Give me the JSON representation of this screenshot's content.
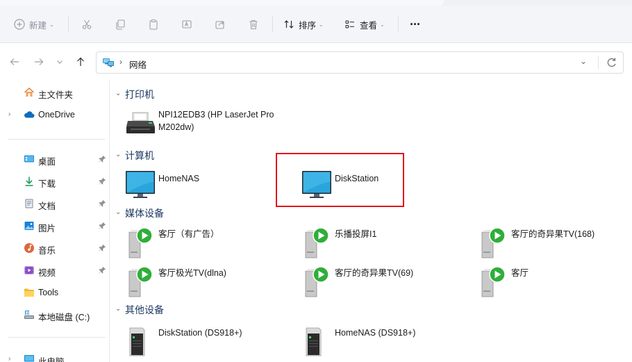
{
  "toolbar": {
    "new_label": "新建",
    "sort_label": "排序",
    "view_label": "查看",
    "more": "···"
  },
  "address": {
    "location": "网络"
  },
  "sidebar": {
    "items": [
      {
        "label": "主文件夹",
        "icon": "home-icon"
      },
      {
        "label": "OneDrive",
        "icon": "cloud-icon"
      },
      {
        "label": "桌面",
        "icon": "desktop-icon"
      },
      {
        "label": "下载",
        "icon": "download-icon"
      },
      {
        "label": "文档",
        "icon": "document-icon"
      },
      {
        "label": "图片",
        "icon": "picture-icon"
      },
      {
        "label": "音乐",
        "icon": "music-icon"
      },
      {
        "label": "视频",
        "icon": "video-icon"
      },
      {
        "label": "Tools",
        "icon": "folder-icon"
      },
      {
        "label": "本地磁盘 (C:)",
        "icon": "drive-icon"
      },
      {
        "label": "此电脑",
        "icon": "computer-icon"
      }
    ]
  },
  "groups": {
    "printers": "打印机",
    "computers": "计算机",
    "media": "媒体设备",
    "other": "其他设备"
  },
  "printers": [
    {
      "line1": "NPI12EDB3 (HP LaserJet Pro",
      "line2": "M202dw)"
    }
  ],
  "computers": [
    "HomeNAS",
    "DiskStation"
  ],
  "media": [
    "客厅（有广告）",
    "乐播投屏I1",
    "客厅的奇异果TV(168)",
    "客厅极光TV(dlna)",
    "客厅的奇异果TV(69)",
    "客厅"
  ],
  "other": [
    "DiskStation (DS918+)",
    "HomeNAS (DS918+)"
  ],
  "colors": {
    "highlight": "#e0141b",
    "group_title": "#1f3a63",
    "accent": "#0067c0"
  }
}
